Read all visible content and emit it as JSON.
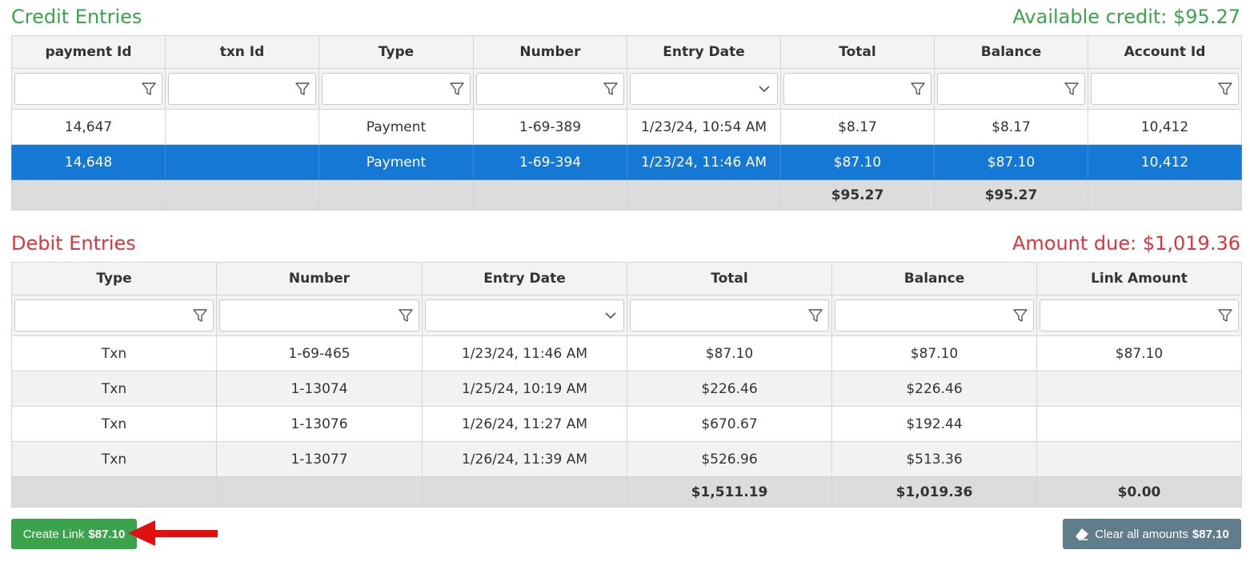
{
  "credit": {
    "title": "Credit Entries",
    "summary": "Available credit: $95.27",
    "columns": [
      "payment Id",
      "txn Id",
      "Type",
      "Number",
      "Entry Date",
      "Total",
      "Balance",
      "Account Id"
    ],
    "filters": [
      "filter",
      "filter",
      "filter",
      "filter",
      "dropdown",
      "filter",
      "filter",
      "filter"
    ],
    "rows": [
      [
        "14,647",
        "",
        "Payment",
        "1-69-389",
        "1/23/24, 10:54 AM",
        "$8.17",
        "$8.17",
        "10,412"
      ],
      [
        "14,648",
        "",
        "Payment",
        "1-69-394",
        "1/23/24, 11:46 AM",
        "$87.10",
        "$87.10",
        "10,412"
      ]
    ],
    "selected_row": 1,
    "totals": [
      "",
      "",
      "",
      "",
      "",
      "$95.27",
      "$95.27",
      ""
    ]
  },
  "debit": {
    "title": "Debit Entries",
    "summary": "Amount due: $1,019.36",
    "columns": [
      "Type",
      "Number",
      "Entry Date",
      "Total",
      "Balance",
      "Link Amount"
    ],
    "filters": [
      "filter",
      "filter",
      "dropdown",
      "filter",
      "filter",
      "filter"
    ],
    "rows": [
      [
        "Txn",
        "1-69-465",
        "1/23/24, 11:46 AM",
        "$87.10",
        "$87.10",
        "$87.10"
      ],
      [
        "Txn",
        "1-13074",
        "1/25/24, 10:19 AM",
        "$226.46",
        "$226.46",
        ""
      ],
      [
        "Txn",
        "1-13076",
        "1/26/24, 11:27 AM",
        "$670.67",
        "$192.44",
        ""
      ],
      [
        "Txn",
        "1-13077",
        "1/26/24, 11:39 AM",
        "$526.96",
        "$513.36",
        ""
      ]
    ],
    "totals": [
      "",
      "",
      "",
      "$1,511.19",
      "$1,019.36",
      "$0.00"
    ]
  },
  "actions": {
    "create_label": "Create Link",
    "create_amount": "$87.10",
    "clear_label": "Clear all amounts",
    "clear_amount": "$87.10",
    "clear_icon": "eraser-icon"
  },
  "colors": {
    "credit_accent": "#3ba34b",
    "debit_accent": "#d9363e",
    "selected_row": "#1478d4",
    "clear_button": "#607d8b",
    "arrow": "#e01010"
  }
}
